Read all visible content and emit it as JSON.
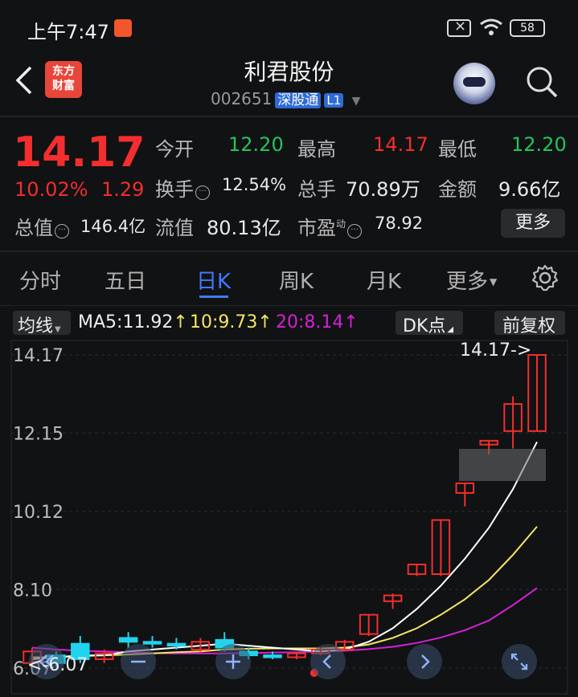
{
  "status_bar": {
    "time": "上午7:47",
    "battery": "58"
  },
  "header": {
    "logo_line1": "东方",
    "logo_line2": "财富",
    "stock_name": "利君股份",
    "stock_code": "002651",
    "market_tag": "深股通",
    "level_tag": "L1"
  },
  "quote": {
    "price": "14.17",
    "change_pct": "10.02%",
    "change": "1.29",
    "open_label": "今开",
    "open": "12.20",
    "high_label": "最高",
    "high": "14.17",
    "low_label": "最低",
    "low": "12.20",
    "turnover_label": "换手",
    "turnover": "12.54%",
    "volume_label": "总手",
    "volume": "70.89万",
    "amount_label": "金额",
    "amount": "9.66亿",
    "mcap_label": "总值",
    "mcap": "146.4亿",
    "float_label": "流值",
    "float_cap": "80.13亿",
    "pe_label": "市盈",
    "pe_super": "动",
    "pe": "78.92",
    "more": "更多"
  },
  "tabs": [
    {
      "label": "分时"
    },
    {
      "label": "五日"
    },
    {
      "label": "日K"
    },
    {
      "label": "周K"
    },
    {
      "label": "月K"
    },
    {
      "label": "更多"
    }
  ],
  "ma_bar": {
    "mode": "均线",
    "ma5": "MA5:11.92",
    "ma10": "10:9.73",
    "ma20": "20:8.14",
    "dk": "DK点",
    "adjust": "前复权"
  },
  "colors": {
    "up": "#f22e2e",
    "down": "#22d3ee",
    "ma5": "#ffffff",
    "ma10": "#f5e663",
    "ma20": "#d620d6",
    "accent": "#3e7bff"
  },
  "chart_data": {
    "type": "candlestick",
    "y_ticks": [
      "14.17",
      "12.15",
      "10.12",
      "8.10",
      "6.07"
    ],
    "ylim": [
      6.07,
      14.17
    ],
    "max_label": "14.17->",
    "min_label": "<-6.07",
    "candles": [
      {
        "o": 6.2,
        "c": 6.5,
        "h": 6.6,
        "l": 6.1
      },
      {
        "o": 6.4,
        "c": 6.2,
        "h": 6.5,
        "l": 6.1
      },
      {
        "o": 6.7,
        "c": 6.3,
        "h": 6.9,
        "l": 6.2
      },
      {
        "o": 6.3,
        "c": 6.45,
        "h": 6.55,
        "l": 6.2
      },
      {
        "o": 6.85,
        "c": 6.75,
        "h": 7.0,
        "l": 6.6
      },
      {
        "o": 6.75,
        "c": 6.7,
        "h": 6.9,
        "l": 6.6
      },
      {
        "o": 6.7,
        "c": 6.65,
        "h": 6.85,
        "l": 6.55
      },
      {
        "o": 6.55,
        "c": 6.75,
        "h": 6.85,
        "l": 6.5
      },
      {
        "o": 6.8,
        "c": 6.6,
        "h": 7.0,
        "l": 6.5
      },
      {
        "o": 6.5,
        "c": 6.4,
        "h": 6.6,
        "l": 6.3
      },
      {
        "o": 6.4,
        "c": 6.35,
        "h": 6.5,
        "l": 6.3
      },
      {
        "o": 6.35,
        "c": 6.45,
        "h": 6.5,
        "l": 6.3
      },
      {
        "o": 6.45,
        "c": 6.55,
        "h": 6.6,
        "l": 6.4
      },
      {
        "o": 6.55,
        "c": 6.75,
        "h": 6.8,
        "l": 6.5
      },
      {
        "o": 6.95,
        "c": 7.45,
        "h": 7.45,
        "l": 6.9
      },
      {
        "o": 7.8,
        "c": 7.95,
        "h": 8.0,
        "l": 7.6
      },
      {
        "o": 8.5,
        "c": 8.75,
        "h": 8.75,
        "l": 8.45
      },
      {
        "o": 8.5,
        "c": 9.9,
        "h": 9.9,
        "l": 8.45
      },
      {
        "o": 10.6,
        "c": 10.85,
        "h": 10.85,
        "l": 10.25
      },
      {
        "o": 11.85,
        "c": 11.95,
        "h": 11.95,
        "l": 11.6
      },
      {
        "o": 12.2,
        "c": 12.9,
        "h": 13.1,
        "l": 11.75
      },
      {
        "o": 12.2,
        "c": 14.17,
        "h": 14.17,
        "l": 12.2
      }
    ],
    "ma5": [
      6.3,
      6.35,
      6.4,
      6.4,
      6.5,
      6.55,
      6.6,
      6.65,
      6.7,
      6.65,
      6.6,
      6.55,
      6.5,
      6.55,
      6.75,
      7.1,
      7.6,
      8.2,
      8.9,
      9.7,
      10.7,
      11.92
    ],
    "ma10": [
      6.35,
      6.35,
      6.38,
      6.4,
      6.42,
      6.45,
      6.48,
      6.5,
      6.55,
      6.57,
      6.58,
      6.58,
      6.58,
      6.6,
      6.68,
      6.85,
      7.1,
      7.45,
      7.85,
      8.35,
      9.0,
      9.73
    ],
    "ma20": [
      6.6,
      6.55,
      6.52,
      6.5,
      6.48,
      6.46,
      6.45,
      6.45,
      6.45,
      6.46,
      6.47,
      6.48,
      6.5,
      6.52,
      6.56,
      6.62,
      6.72,
      6.86,
      7.05,
      7.3,
      7.7,
      8.14
    ]
  }
}
